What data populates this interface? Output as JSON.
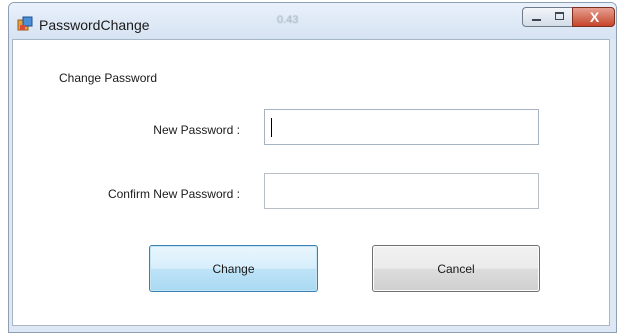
{
  "window": {
    "title": "PasswordChange",
    "title_ghost": "0.43",
    "caption": {
      "close_glyph": "X"
    }
  },
  "form": {
    "group_title": "Change Password",
    "new_password_label": "New Password :",
    "confirm_password_label": "Confirm New Password :",
    "new_password_value": "",
    "confirm_password_value": ""
  },
  "buttons": {
    "change_label": "Change",
    "cancel_label": "Cancel"
  },
  "colors": {
    "close_button": "#c5452a",
    "focused_button_border": "#3c7fb1"
  }
}
